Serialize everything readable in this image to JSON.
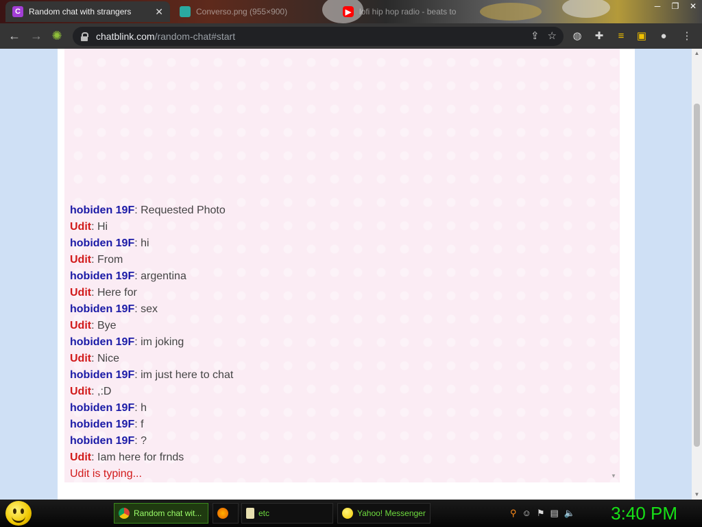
{
  "browser": {
    "tabs": [
      {
        "title": "Random chat with strangers",
        "favicon": "C",
        "favicon_color": "#a33ed6"
      },
      {
        "title": "Converso.png (955×900)",
        "favicon_color": "#2aa9a0"
      },
      {
        "title": "lofi hip hop radio - beats to",
        "favicon_color": "#ff0000"
      }
    ],
    "url_host": "chatblink.com",
    "url_path": "/random-chat#start"
  },
  "chat": {
    "messages": [
      {
        "sender": "hobiden 19F",
        "role": "stranger",
        "text": ": Requested Photo"
      },
      {
        "sender": "Udit",
        "role": "you",
        "text": ": Hi"
      },
      {
        "sender": "hobiden 19F",
        "role": "stranger",
        "text": ": hi"
      },
      {
        "sender": "Udit",
        "role": "you",
        "text": ": From"
      },
      {
        "sender": "hobiden 19F",
        "role": "stranger",
        "text": ": argentina"
      },
      {
        "sender": "Udit",
        "role": "you",
        "text": ": Here for"
      },
      {
        "sender": "hobiden 19F",
        "role": "stranger",
        "text": ": sex"
      },
      {
        "sender": "Udit",
        "role": "you",
        "text": ": Bye"
      },
      {
        "sender": "hobiden 19F",
        "role": "stranger",
        "text": ": im joking"
      },
      {
        "sender": "Udit",
        "role": "you",
        "text": ": Nice"
      },
      {
        "sender": "hobiden 19F",
        "role": "stranger",
        "text": ": im just here to chat"
      },
      {
        "sender": "Udit",
        "role": "you",
        "text": ": ,:D"
      },
      {
        "sender": "hobiden 19F",
        "role": "stranger",
        "text": ": h"
      },
      {
        "sender": "hobiden 19F",
        "role": "stranger",
        "text": ": f"
      },
      {
        "sender": "hobiden 19F",
        "role": "stranger",
        "text": ": ?"
      },
      {
        "sender": "Udit",
        "role": "you",
        "text": ": Iam here for frnds"
      }
    ],
    "typing_status": "Udit is typing..."
  },
  "taskbar": {
    "buttons": [
      {
        "label": "Random chat wit...",
        "icon": "chrome-icon"
      },
      {
        "label": "",
        "icon": "firefox-icon"
      },
      {
        "label": "etc",
        "icon": "folder-icon"
      },
      {
        "label": "Yahoo! Messenger",
        "icon": "yahoo-messenger-icon"
      }
    ],
    "clock": "3:40 PM"
  },
  "colors": {
    "stranger_name": "#1a1aa6",
    "you_name": "#d11a1a",
    "chat_bg": "#fbecf4",
    "clock": "#17e117"
  }
}
